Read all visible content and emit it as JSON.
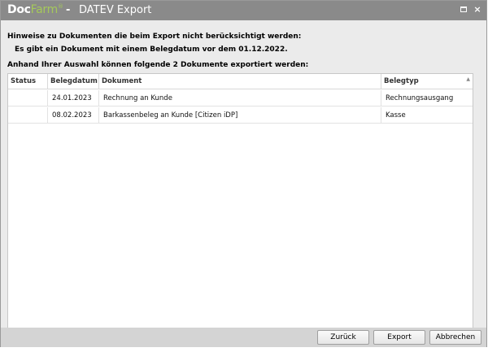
{
  "titlebar": {
    "logo_doc": "Doc",
    "logo_farm": "Farm",
    "logo_reg": "®",
    "separator": "-",
    "title": "DATEV Export",
    "maximize_icon": "maximize-icon",
    "close_icon": "close-icon",
    "close_glyph": "×"
  },
  "hints": {
    "heading": "Hinweise zu Dokumenten die beim Export nicht berücksichtigt werden:",
    "items": [
      "Es gibt ein Dokument mit einem Belegdatum vor dem 01.12.2022."
    ]
  },
  "export": {
    "heading": "Anhand Ihrer Auswahl können folgende 2 Dokumente exportiert werden:"
  },
  "table": {
    "columns": [
      "Status",
      "Belegdatum",
      "Dokument",
      "Belegtyp"
    ],
    "rows": [
      {
        "status": "",
        "belegdatum": "24.01.2023",
        "dokument": "Rechnung an Kunde",
        "belegtyp": "Rechnungsausgang"
      },
      {
        "status": "",
        "belegdatum": "08.02.2023",
        "dokument": "Barkassenbeleg an Kunde [Citizen iDP]",
        "belegtyp": "Kasse"
      }
    ]
  },
  "buttons": {
    "back": "Zurück",
    "export": "Export",
    "cancel": "Abbrechen"
  },
  "colors": {
    "titlebar": "#8a8a8a",
    "logo_accent": "#a5c95a",
    "background": "#ebebeb"
  }
}
